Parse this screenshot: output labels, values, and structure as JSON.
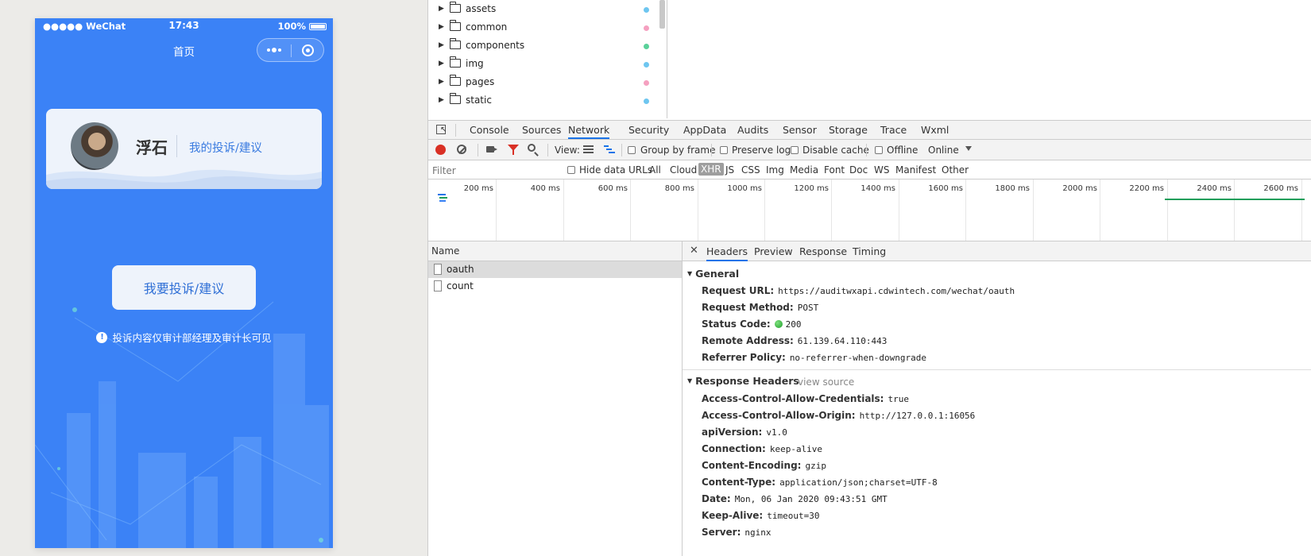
{
  "phone": {
    "status": {
      "carrier": "●●●●● WeChat",
      "time": "17:43",
      "battery": "100%"
    },
    "nav_title": "首页",
    "profile": {
      "name": "浮石",
      "link": "我的投诉/建议"
    },
    "main_button": "我要投诉/建议",
    "notice": "投诉内容仅审计部经理及审计长可见",
    "accent_color": "#3b82f6"
  },
  "devtools": {
    "file_tree": [
      {
        "name": "assets",
        "dot_color": "#6ec6f0"
      },
      {
        "name": "common",
        "dot_color": "#f5a0c0"
      },
      {
        "name": "components",
        "dot_color": "#5ad19a"
      },
      {
        "name": "img",
        "dot_color": "#6ec6f0"
      },
      {
        "name": "pages",
        "dot_color": "#f5a0c0"
      },
      {
        "name": "static",
        "dot_color": "#6ec6f0"
      }
    ],
    "tabs": [
      "Console",
      "Sources",
      "Network",
      "Security",
      "AppData",
      "Audits",
      "Sensor",
      "Storage",
      "Trace",
      "Wxml"
    ],
    "active_tab": "Network",
    "toolbar": {
      "view_label": "View:",
      "group_by_frame": "Group by frame",
      "preserve_log": "Preserve log",
      "disable_cache": "Disable cache",
      "offline": "Offline",
      "throttle": "Online"
    },
    "filter": {
      "placeholder": "Filter",
      "hide_data_urls": "Hide data URLs",
      "types": [
        "All",
        "Cloud",
        "XHR",
        "JS",
        "CSS",
        "Img",
        "Media",
        "Font",
        "Doc",
        "WS",
        "Manifest",
        "Other"
      ],
      "active_type": "XHR"
    },
    "timeline_ticks": [
      "200 ms",
      "400 ms",
      "600 ms",
      "800 ms",
      "1000 ms",
      "1200 ms",
      "1400 ms",
      "1600 ms",
      "1800 ms",
      "2000 ms",
      "2200 ms",
      "2400 ms",
      "2600 ms"
    ],
    "request_list": {
      "header": "Name",
      "items": [
        "oauth",
        "count"
      ],
      "selected": "oauth"
    },
    "details": {
      "tabs": [
        "Headers",
        "Preview",
        "Response",
        "Timing"
      ],
      "active_tab": "Headers",
      "close_glyph": "✕",
      "general": {
        "title": "General",
        "rows": [
          {
            "key": "Request URL:",
            "value": "https://auditwxapi.cdwintech.com/wechat/oauth"
          },
          {
            "key": "Request Method:",
            "value": "POST"
          },
          {
            "key": "Status Code:",
            "value": "200"
          },
          {
            "key": "Remote Address:",
            "value": "61.139.64.110:443"
          },
          {
            "key": "Referrer Policy:",
            "value": "no-referrer-when-downgrade"
          }
        ]
      },
      "response_headers": {
        "title": "Response Headers",
        "view_source": "view source",
        "rows": [
          {
            "key": "Access-Control-Allow-Credentials:",
            "value": "true"
          },
          {
            "key": "Access-Control-Allow-Origin:",
            "value": "http://127.0.0.1:16056"
          },
          {
            "key": "apiVersion:",
            "value": "v1.0"
          },
          {
            "key": "Connection:",
            "value": "keep-alive"
          },
          {
            "key": "Content-Encoding:",
            "value": "gzip"
          },
          {
            "key": "Content-Type:",
            "value": "application/json;charset=UTF-8"
          },
          {
            "key": "Date:",
            "value": "Mon, 06 Jan 2020 09:43:51 GMT"
          },
          {
            "key": "Keep-Alive:",
            "value": "timeout=30"
          },
          {
            "key": "Server:",
            "value": "nginx"
          }
        ]
      }
    }
  }
}
